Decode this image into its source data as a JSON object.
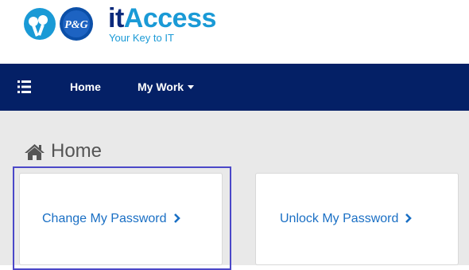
{
  "brand": {
    "title_prefix": "it",
    "title_suffix": "Access",
    "subtitle": "Your Key to IT",
    "logo_text": "P&G",
    "colors": {
      "primary_blue": "#1a9ad6",
      "dark_blue": "#0b2a7c"
    }
  },
  "navbar": {
    "background": "#042066",
    "menu_icon": "hamburger-menu-icon",
    "items": [
      {
        "label": "Home"
      },
      {
        "label": "My Work",
        "has_dropdown": true
      }
    ]
  },
  "page": {
    "title_icon": "home-icon",
    "title": "Home"
  },
  "cards": [
    {
      "label": "Change My Password",
      "icon": "chevron-right-icon",
      "focused": true
    },
    {
      "label": "Unlock My Password",
      "icon": "chevron-right-icon",
      "focused": false
    }
  ],
  "colors": {
    "link": "#1a6fc4",
    "focus_outline": "#4b48c8",
    "content_background": "#e9e9e9"
  }
}
